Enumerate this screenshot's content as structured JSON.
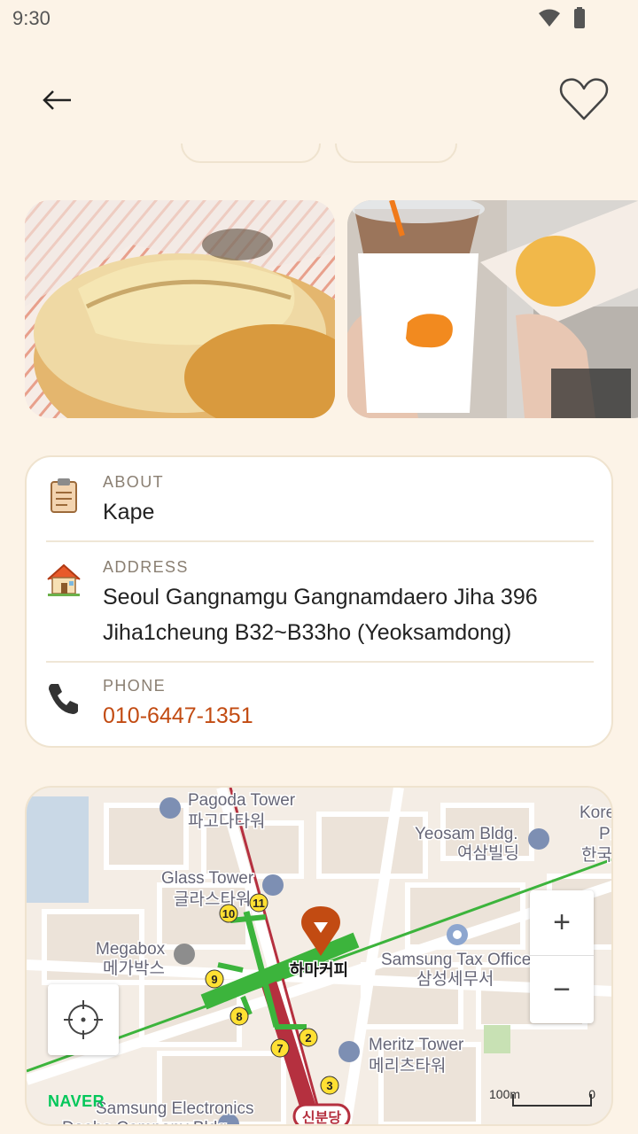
{
  "status_bar": {
    "time": "9:30"
  },
  "info": {
    "about": {
      "label": "ABOUT",
      "value": "Kape"
    },
    "address": {
      "label": "ADDRESS",
      "line1": "Seoul Gangnamgu Gangnamdaero Jiha 396",
      "line2": "Jiha1cheung B32~B33ho (Yeoksamdong)"
    },
    "phone": {
      "label": "PHONE",
      "value": "010-6447-1351"
    }
  },
  "map": {
    "labels": {
      "pagoda_en": "Pagoda Tower",
      "pagoda_ko": "파고다타워",
      "yeosam_en": "Yeosam Bldg.",
      "yeosam_ko": "여삼빌딩",
      "glass_en": "Glass Tower",
      "glass_ko": "글라스타워",
      "megabox_en": "Megabox",
      "megabox_ko": "메가박스",
      "samsung_tax_en": "Samsung Tax Office",
      "samsung_tax_ko": "삼성세무서",
      "meritz_en": "Meritz Tower",
      "meritz_ko": "메리츠타워",
      "samsung_elec_en": "Samsung Electronics",
      "samsung_elec_ko2": "Daehe Company Bldg",
      "kore": "Kore",
      "pr": "Pr",
      "hanguk": "한국",
      "cafe": "하마커피",
      "station": "신분당"
    },
    "exits": [
      "10",
      "11",
      "9",
      "8",
      "7",
      "2",
      "3"
    ],
    "zoom_in": "+",
    "zoom_out": "−",
    "naver": "NAVER",
    "scale": "100m",
    "scale_zero": "0"
  },
  "colors": {
    "accent": "#c24b12",
    "background": "#fcf3e7",
    "subway_green": "#3cb43c",
    "subway_red": "#b5303f"
  }
}
